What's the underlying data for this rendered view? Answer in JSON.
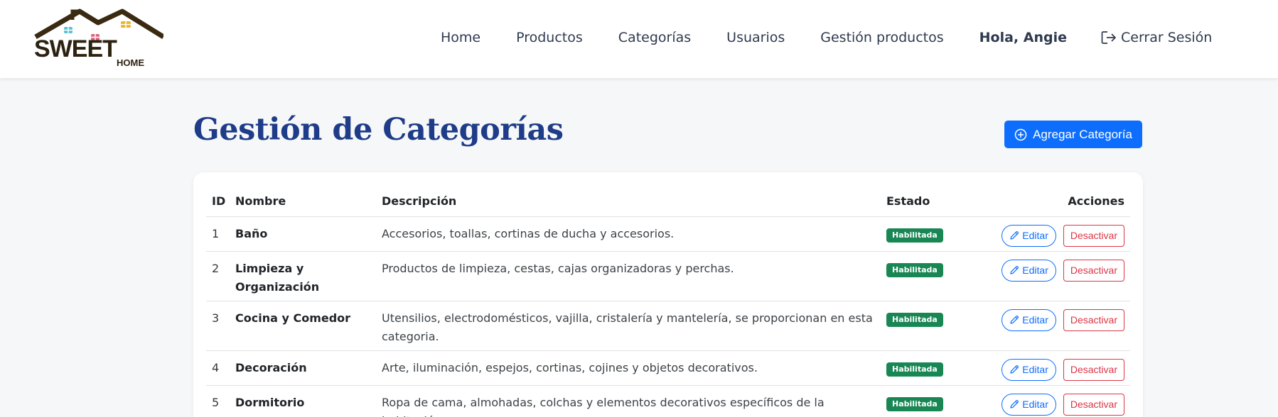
{
  "brand": {
    "logo_text": "SWEET",
    "logo_subtext": "HOME"
  },
  "nav": {
    "items": [
      "Home",
      "Productos",
      "Categorías",
      "Usuarios",
      "Gestión productos"
    ],
    "greeting": "Hola, Angie",
    "logout": "Cerrar Sesión"
  },
  "page": {
    "title": "Gestión de Categorías",
    "add_button": "Agregar Categoría"
  },
  "table": {
    "headers": [
      "ID",
      "Nombre",
      "Descripción",
      "Estado",
      "Acciones"
    ],
    "rows": [
      {
        "id": "1",
        "name": "Baño",
        "desc": "Accesorios, toallas, cortinas de ducha y accesorios.",
        "status": "Habilitada",
        "edit": "Editar",
        "deactivate": "Desactivar"
      },
      {
        "id": "2",
        "name": "Limpieza y Organización",
        "desc": "Productos de limpieza, cestas, cajas organizadoras y perchas.",
        "status": "Habilitada",
        "edit": "Editar",
        "deactivate": "Desactivar"
      },
      {
        "id": "3",
        "name": "Cocina y Comedor",
        "desc": "Utensilios, electrodomésticos, vajilla, cristalería y mantelería, se proporcionan en esta categoria.",
        "status": "Habilitada",
        "edit": "Editar",
        "deactivate": "Desactivar"
      },
      {
        "id": "4",
        "name": "Decoración",
        "desc": "Arte, iluminación, espejos, cortinas, cojines y objetos decorativos.",
        "status": "Habilitada",
        "edit": "Editar",
        "deactivate": "Desactivar"
      },
      {
        "id": "5",
        "name": "Dormitorio",
        "desc": "Ropa de cama, almohadas, colchas y elementos decorativos específicos de la habitación.",
        "status": "Habilitada",
        "edit": "Editar",
        "deactivate": "Desactivar"
      }
    ]
  },
  "colors": {
    "title": "#1f3c88",
    "primary": "#0d6efd",
    "success": "#198754",
    "danger": "#dc3545"
  },
  "icons": {
    "add": "plus-circle-icon",
    "edit": "pencil-icon",
    "logout": "logout-icon"
  }
}
